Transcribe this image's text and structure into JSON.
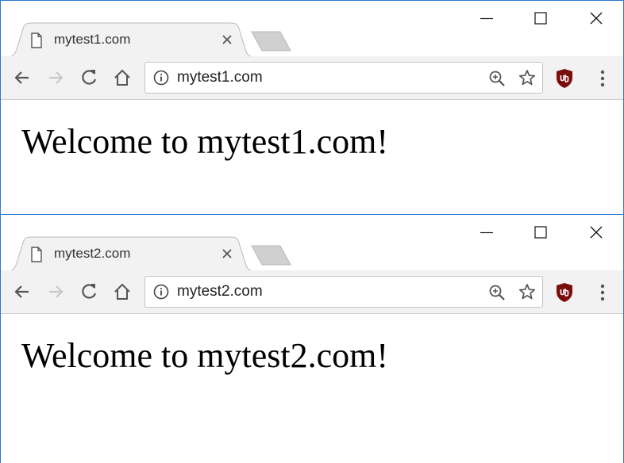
{
  "windows": [
    {
      "tab": {
        "title": "mytest1.com"
      },
      "omnibox": {
        "url": "mytest1.com"
      },
      "page": {
        "heading": "Welcome to mytest1.com!"
      }
    },
    {
      "tab": {
        "title": "mytest2.com"
      },
      "omnibox": {
        "url": "mytest2.com"
      },
      "page": {
        "heading": "Welcome to mytest2.com!"
      }
    }
  ],
  "icons": {
    "tab": "file-icon",
    "tab_close": "close-icon",
    "new_tab": "new-tab-icon",
    "window_controls": [
      "minimize-icon",
      "maximize-icon",
      "close-icon"
    ],
    "navigation": [
      "back-arrow-icon",
      "forward-arrow-icon",
      "reload-icon",
      "home-icon"
    ],
    "omnibox": [
      "info-icon",
      "zoom-icon",
      "star-icon"
    ],
    "extension": "ublock-shield-icon",
    "menu": "kebab-menu-icon"
  },
  "colors": {
    "window_border": "#2b79d0",
    "toolbar_bg": "#f2f2f2",
    "tab_bg": "#f2f2f2",
    "new_tab_fill": "#d0d0d0",
    "icon_gray": "#5a5a5a",
    "disabled_icon": "#c8c8c8",
    "extension_shield": "#7a0c0c"
  }
}
